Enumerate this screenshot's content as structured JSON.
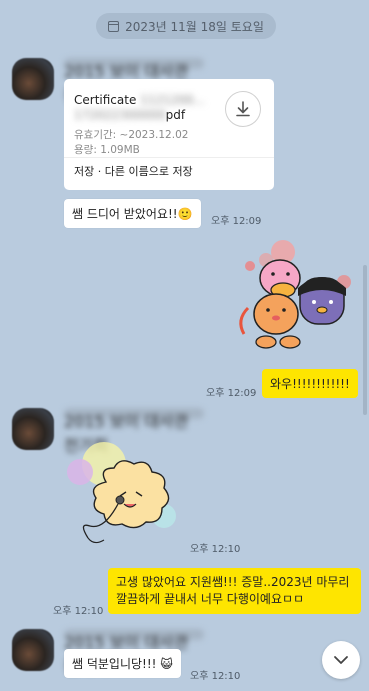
{
  "date_divider": "2023년 11월 18일 토요일",
  "messages": {
    "file": {
      "title": "Certificate",
      "title_hidden": "1121200...",
      "name_hidden": "172022300000",
      "ext": "pdf",
      "expiry": "유효기간: ~2023.12.02",
      "size": "용량: 1.09MB",
      "actions": "저장 · 다른 이름으로 저장"
    },
    "msg1": {
      "text": "쌤 드디어 받았어요!!🙂",
      "time": "오후 12:09"
    },
    "sticker1_time": "오후 12:09",
    "msg2": {
      "text": "와우!!!!!!!!!!!!",
      "time": ""
    },
    "sticker2_time": "오후 12:10",
    "msg3": {
      "text": "고생 많았어요 지원쌤!!! 증말..2023년 마무리 깔끔하게 끝내서 너무 다행이예요ㅁㅁ",
      "time": "오후 12:10"
    },
    "msg4": {
      "text": "쌤 덕분입니당!!! 😺",
      "time": "오후 12:10"
    }
  },
  "sender_name_hidden": "2015 보이 대사관 전기회",
  "icons": {
    "calendar": "calendar-icon",
    "download": "download-icon",
    "scroll_down": "chevron-down-icon"
  },
  "colors": {
    "background": "#b9cbde",
    "my_bubble": "#fee500",
    "their_bubble": "#ffffff"
  }
}
